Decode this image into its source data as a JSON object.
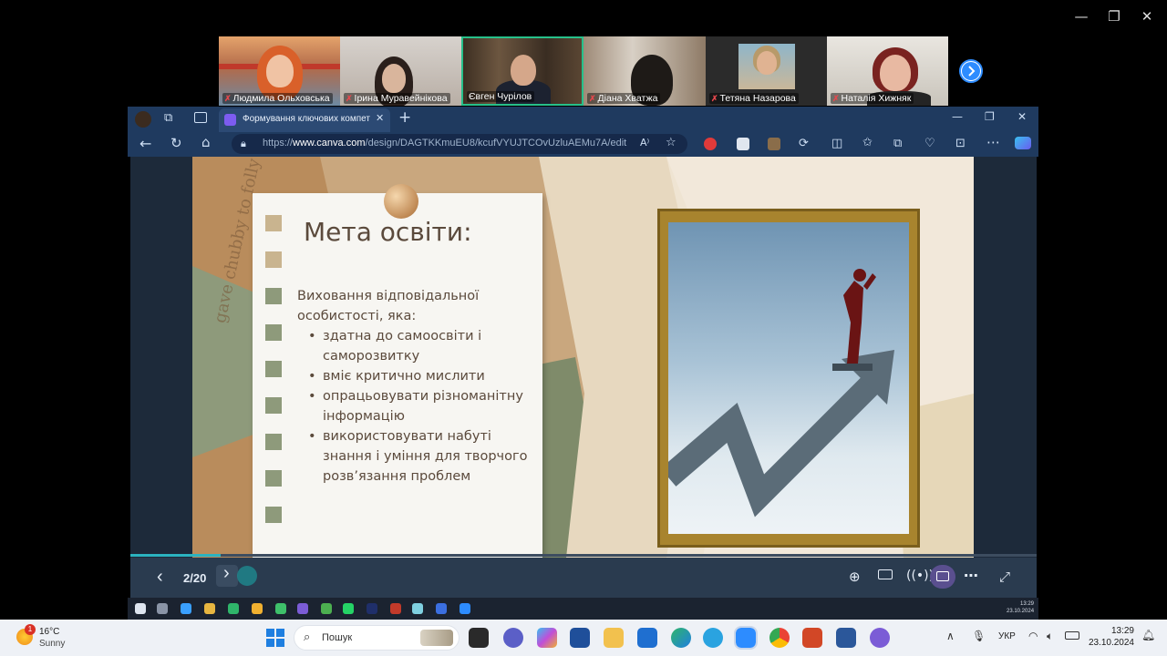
{
  "zoom": {
    "participants": [
      {
        "name": "Людмила Ольховська",
        "muted": true
      },
      {
        "name": "Ірина Муравейнікова",
        "muted": true
      },
      {
        "name": "Євген Чурілов",
        "muted": false,
        "active": true
      },
      {
        "name": "Діана Хватжа",
        "muted": true
      },
      {
        "name": "Тетяна Назарова",
        "muted": true
      },
      {
        "name": "Наталія Хижняк",
        "muted": true
      }
    ],
    "next_icon": "chevron-right-icon",
    "window_controls": {
      "minimize": "—",
      "maximize": "❐",
      "close": "✕"
    }
  },
  "browser": {
    "tab_title": "Формування ключових компете",
    "new_tab": "+",
    "url_prefix": "https://",
    "url_domain": "www.canva.com",
    "url_path": "/design/DAGTKKmuEU8/kcufVYUJTCOvUzluAEMu7A/edit",
    "read_aloud": "A⁾",
    "window_controls": {
      "minimize": "—",
      "maximize": "❐",
      "close": "✕"
    }
  },
  "slide": {
    "title": "Мета освіти:",
    "intro_line1": "Виховання відповідальної",
    "intro_line2": "особистості, яка:",
    "bullets": [
      {
        "line1": "здатна до самоосвіти і",
        "line2": "саморозвитку"
      },
      {
        "line1": "вміє критично мислити",
        "line2": ""
      },
      {
        "line1": "опрацьовувати різноманітну",
        "line2": "інформацію"
      },
      {
        "line1": "використовувати набуті",
        "line2": "знання і уміння для творчого",
        "line3": "розв’язання проблем"
      }
    ],
    "bg_text_left": "gave chubby to folly"
  },
  "presenter": {
    "prev": "‹",
    "page": "2/20",
    "next": "›",
    "progress": 0.1
  },
  "mini_tray": {
    "time": "13:29",
    "date": "23.10.2024"
  },
  "taskbar": {
    "weather_badge": "1",
    "temp": "16°C",
    "condition": "Sunny",
    "search_placeholder": "Пошук",
    "lang": "УКР",
    "time": "13:29",
    "date": "23.10.2024"
  }
}
